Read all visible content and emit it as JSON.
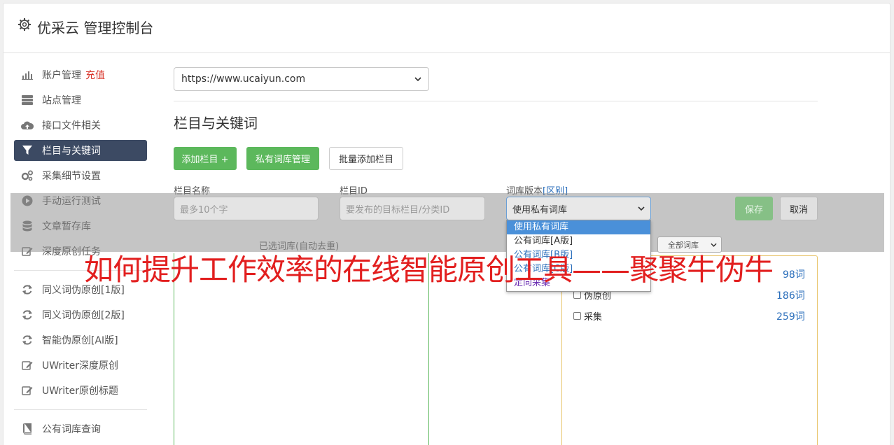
{
  "header": {
    "title": "优采云 管理控制台"
  },
  "sidebar": {
    "items": [
      {
        "label": "账户管理",
        "tag": "充值",
        "icon": "bar-chart-icon"
      },
      {
        "label": "站点管理",
        "icon": "server-icon"
      },
      {
        "label": "接口文件相关",
        "icon": "cloud-upload-icon"
      },
      {
        "label": "栏目与关键词",
        "icon": "filter-icon",
        "active": true
      },
      {
        "label": "采集细节设置",
        "icon": "cogs-icon"
      },
      {
        "label": "手动运行测试",
        "icon": "play-icon"
      },
      {
        "label": "文章暂存库",
        "icon": "database-icon"
      },
      {
        "label": "深度原创任务",
        "icon": "edit-icon"
      }
    ],
    "items2": [
      {
        "label": "同义词伪原创[1版]",
        "icon": "refresh-icon"
      },
      {
        "label": "同义词伪原创[2版]",
        "icon": "refresh-icon"
      },
      {
        "label": "智能伪原创[AI版]",
        "icon": "refresh-icon"
      },
      {
        "label": "UWriter深度原创",
        "icon": "edit-icon"
      },
      {
        "label": "UWriter原创标题",
        "icon": "edit-icon"
      }
    ],
    "items3": [
      {
        "label": "公有词库查询",
        "icon": "book-icon"
      }
    ]
  },
  "main": {
    "site_select": "https://www.ucaiyun.com",
    "section_title": "栏目与关键词",
    "buttons": {
      "add_column": "添加栏目 +",
      "private_lib": "私有词库管理",
      "batch_add": "批量添加栏目"
    },
    "form": {
      "name_label": "栏目名称",
      "name_placeholder": "最多10个字",
      "id_label": "栏目ID",
      "id_placeholder": "要发布的目标栏目/分类ID",
      "version_label": "词库版本",
      "version_link": "[区别]",
      "version_value": "使用私有词库",
      "save": "保存",
      "cancel": "取消"
    },
    "selected_title": "已选词库(自动去重)",
    "filter_select": "全部词库",
    "libraries": [
      {
        "name": "",
        "count": "98词"
      },
      {
        "name": "伪原创",
        "count": "186词"
      },
      {
        "name": "采集",
        "count": "259词"
      }
    ],
    "dropdown_options": [
      "使用私有词库",
      "公有词库[A版]",
      "公有词库[B版]",
      "公有词库[C版]",
      "定向采集"
    ]
  },
  "overlay_caption": "如何提升工作效率的在线智能原创工具——聚聚牛伪牛",
  "colors": {
    "green": "#5cb85c",
    "nav_active": "#3c4a63",
    "accent_red": "#e21f1f",
    "link_blue": "#2a6ebb"
  }
}
